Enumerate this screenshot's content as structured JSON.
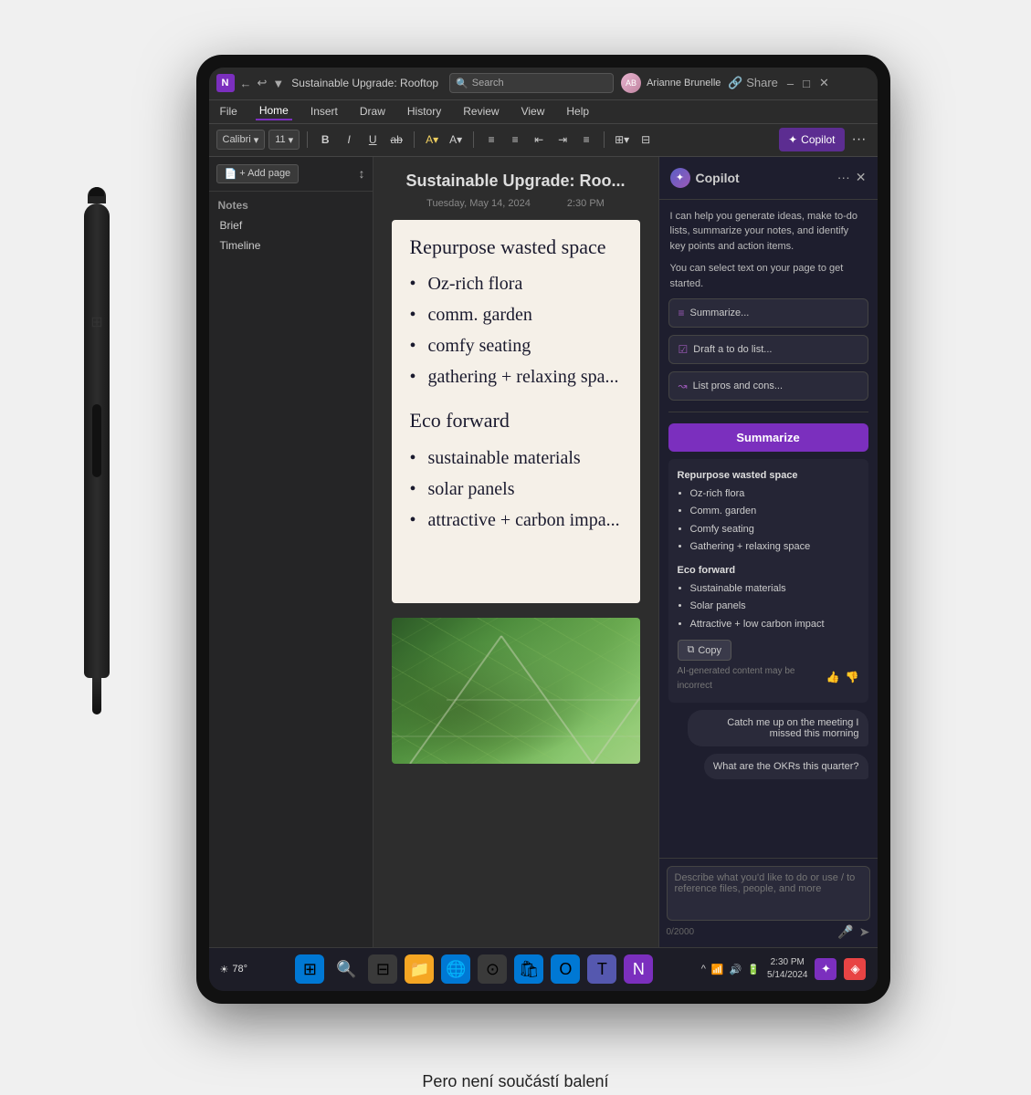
{
  "caption": "Pero není součástí balení",
  "titlebar": {
    "app_icon": "N",
    "title": "Sustainable Upgrade: Rooftop",
    "search_placeholder": "Search",
    "user_name": "Arianne Brunelle",
    "minimize": "–",
    "maximize": "□",
    "close": "✕"
  },
  "menubar": {
    "items": [
      "File",
      "Home",
      "Insert",
      "Draw",
      "History",
      "Review",
      "View",
      "Help"
    ]
  },
  "toolbar": {
    "font": "Calibri",
    "size": "11",
    "bold": "B",
    "italic": "I",
    "underline": "U",
    "strikethrough": "ab",
    "highlight": "A",
    "font_color": "A",
    "bullets": "≡",
    "numbering": "≡",
    "indent_less": "←",
    "indent_more": "→",
    "align": "≡",
    "copilot_label": "Copilot",
    "more": "···"
  },
  "sidebar": {
    "add_page": "+ Add page",
    "section_label": "Notes",
    "items": [
      "Brief",
      "Timeline"
    ]
  },
  "note": {
    "title": "Sustainable Upgrade: Roo...",
    "date": "Tuesday, May 14, 2024",
    "time": "2:30 PM",
    "handwritten_title": "Repurpose wasted space",
    "bullets_section1": [
      "Oz-rich flora",
      "comm. garden",
      "comfy seating",
      "gathering + relaxing spa..."
    ],
    "section2_title": "Eco forward",
    "bullets_section2": [
      "sustainable materials",
      "solar panels",
      "attractive + carbon impa..."
    ]
  },
  "copilot": {
    "title": "Copilot",
    "intro": "I can help you generate ideas, make to-do lists, summarize your notes, and identify key points and action items.",
    "intro2": "You can select text on your page to get started.",
    "actions": [
      {
        "icon": "≡",
        "label": "Summarize..."
      },
      {
        "icon": "☑",
        "label": "Draft a to do list..."
      },
      {
        "icon": "~",
        "label": "List pros and cons..."
      }
    ],
    "summarize_btn": "Summarize",
    "summary": {
      "heading1": "Repurpose wasted space",
      "bullets1": [
        "Oz-rich flora",
        "Comm. garden",
        "Comfy seating",
        "Gathering + relaxing space"
      ],
      "heading2": "Eco forward",
      "bullets2": [
        "Sustainable materials",
        "Solar panels",
        "Attractive + low carbon impact"
      ]
    },
    "copy_btn": "Copy",
    "ai_disclaimer": "AI-generated content may be incorrect",
    "followup1": "Catch me up on the meeting I missed this morning",
    "followup2": "What are the OKRs this quarter?",
    "input_placeholder": "Describe what you'd like to do or use / to reference files, people, and more",
    "char_count": "0/2000"
  },
  "taskbar": {
    "temperature": "78°",
    "time": "2:30 PM",
    "date": "5/14/2024",
    "icons": {
      "windows": "⊞",
      "search": "🔍",
      "taskview": "⊟",
      "explorer": "📁",
      "edge": "🌐",
      "chrome": "⊙",
      "store": "🛍",
      "outlook": "📧",
      "teams": "T",
      "onenote": "N",
      "mic": "🎤",
      "weather": "☀",
      "dots": "···",
      "chevron": "^",
      "wifi": "📶",
      "volume": "🔊",
      "battery": "🔋",
      "copilot2": "C",
      "widgets": "W"
    }
  }
}
